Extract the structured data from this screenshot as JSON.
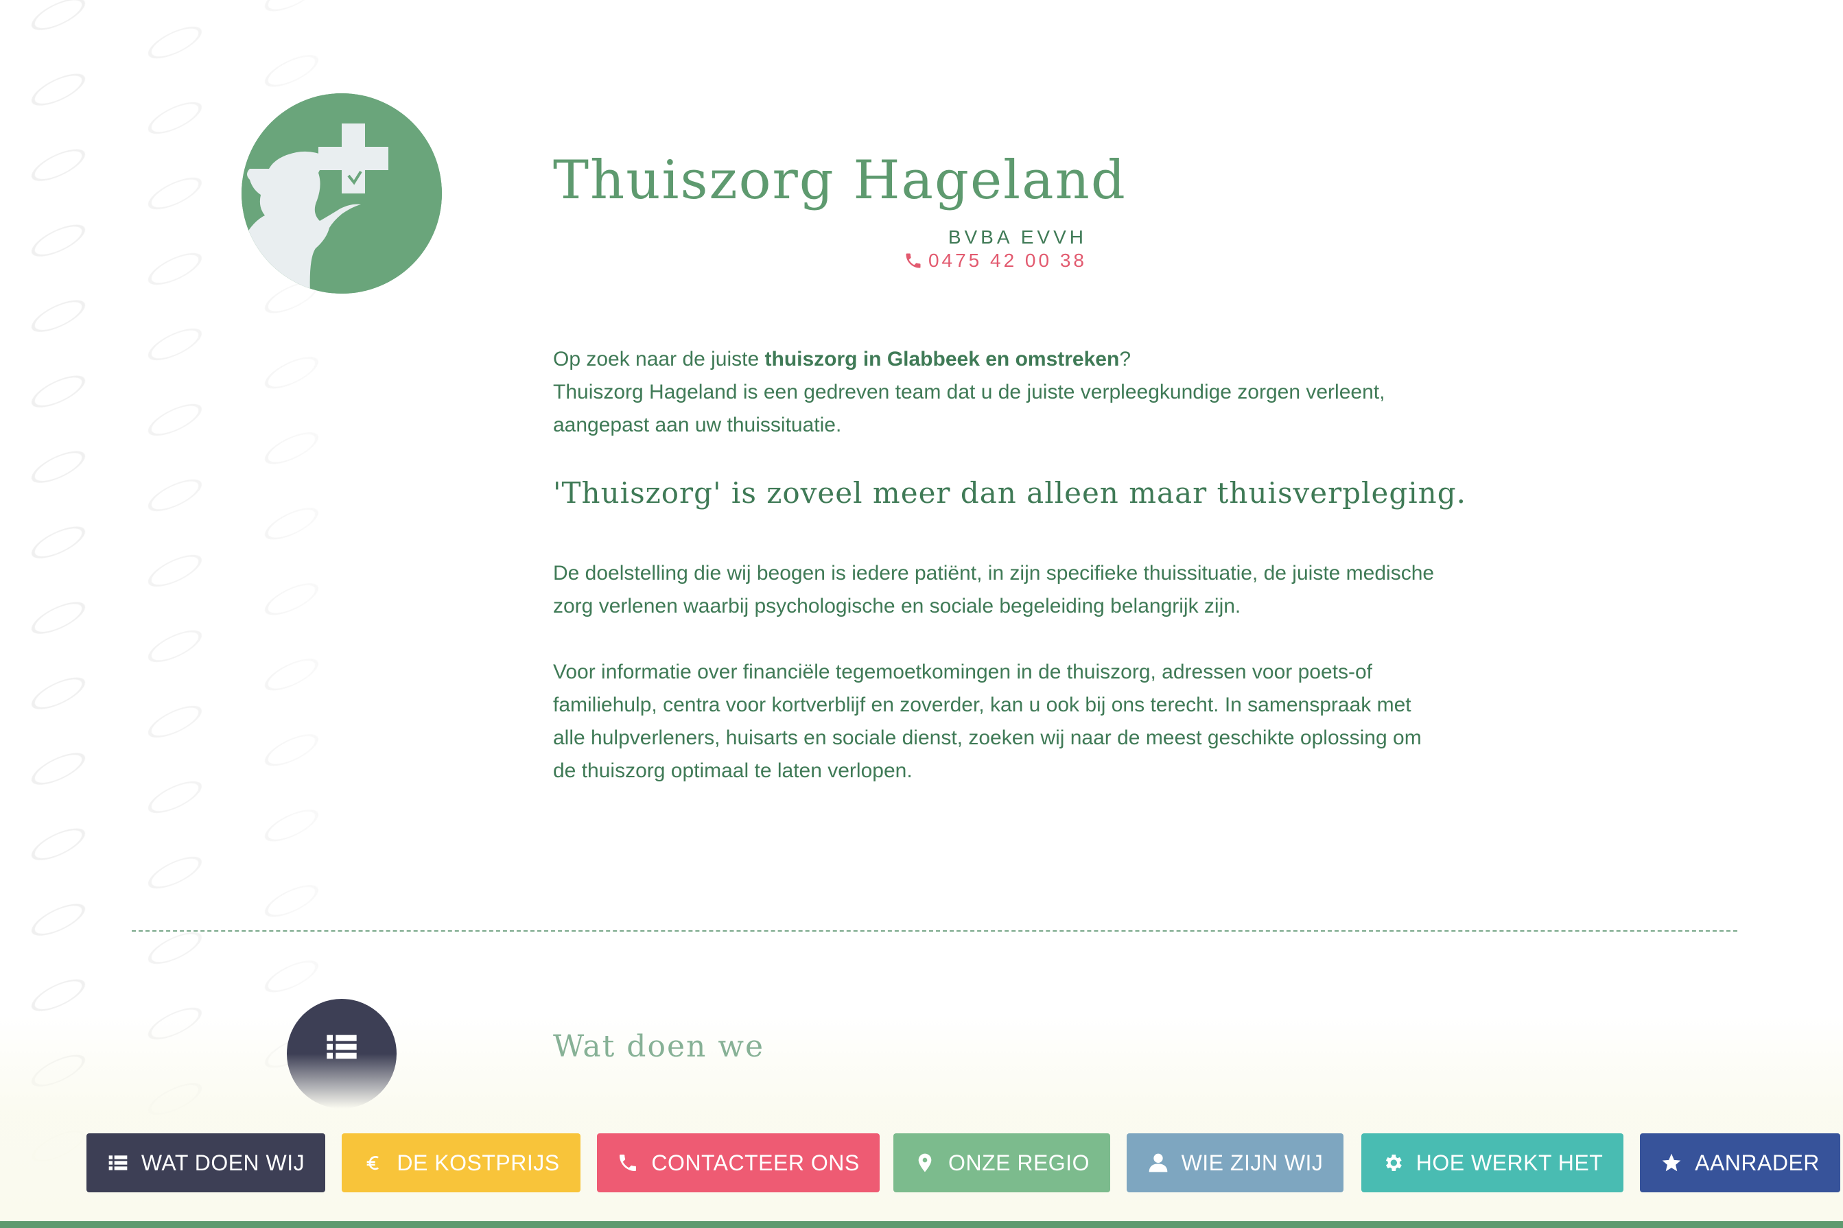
{
  "header": {
    "title": "Thuiszorg Hageland",
    "subtitle": "BVBA EVVH",
    "phone": "0475 42 00 38"
  },
  "intro": {
    "line1_prefix": "Op zoek naar de juiste ",
    "line1_bold": "thuiszorg in Glabbeek en omstreken",
    "line1_suffix": "?",
    "line2": "Thuiszorg Hageland is een gedreven team dat u de juiste verpleegkundige zorgen verleent, aangepast aan uw thuissituatie."
  },
  "quote": "'Thuiszorg' is zoveel meer dan alleen maar thuisverpleging.",
  "paragraphs": [
    "De doelstelling die wij beogen is iedere patiënt, in zijn specifieke thuissituatie, de juiste medische zorg verlenen waarbij psychologische en sociale begeleiding belangrijk zijn.",
    "Voor informatie over financiële tegemoetkomingen in de thuiszorg, adressen voor poets-of familiehulp, centra voor kortverblijf en zoverder, kan u ook bij ons terecht. In samenspraak met alle hulpverleners, huisarts en sociale dienst, zoeken wij naar de meest geschikte oplossing om de thuiszorg optimaal te laten verlopen."
  ],
  "section": {
    "title": "Wat doen we",
    "icon": "list-icon"
  },
  "nav": [
    {
      "label": "WAT DOEN WIJ",
      "icon": "list-icon",
      "color": "#3d3f55"
    },
    {
      "label": "DE KOSTPRIJS",
      "icon": "euro-icon",
      "color": "#f8c43a"
    },
    {
      "label": "CONTACTEER ONS",
      "icon": "phone-icon",
      "color": "#ee5b73"
    },
    {
      "label": "ONZE REGIO",
      "icon": "map-marker-icon",
      "color": "#7cbb8d"
    },
    {
      "label": "WIE ZIJN WIJ",
      "icon": "user-icon",
      "color": "#7ea6c0"
    },
    {
      "label": "HOE WERKT HET",
      "icon": "gear-icon",
      "color": "#49bcb2"
    },
    {
      "label": "AANRADER",
      "icon": "star-icon",
      "color": "#37539a"
    }
  ],
  "colors": {
    "brand_green": "#5e9a6f",
    "text_green": "#3f7a56",
    "phone_red": "#e25a6f"
  }
}
